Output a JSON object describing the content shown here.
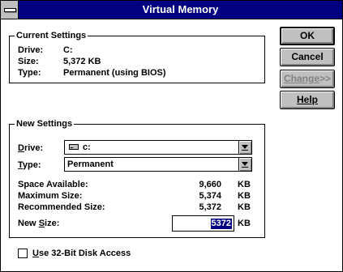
{
  "window": {
    "title": "Virtual Memory"
  },
  "current_settings": {
    "title": "Current Settings",
    "drive_label": "Drive:",
    "drive_value": "C:",
    "size_label": "Size:",
    "size_value": "5,372 KB",
    "type_label": "Type:",
    "type_value": "Permanent (using BIOS)"
  },
  "buttons": {
    "ok": "OK",
    "cancel": "Cancel",
    "change_prefix": "Change",
    "change_suffix": ">>",
    "help": "Help"
  },
  "new_settings": {
    "title": "New Settings",
    "drive_label_u": "D",
    "drive_label_rest": "rive:",
    "drive_value": "c:",
    "type_label_u": "T",
    "type_label_rest": "ype:",
    "type_value": "Permanent",
    "space_available_label": "Space Available:",
    "space_available_value": "9,660",
    "maximum_size_label": "Maximum Size:",
    "maximum_size_value": "5,374",
    "recommended_size_label": "Recommended Size:",
    "recommended_size_value": "5,372",
    "unit": "KB",
    "new_size_label_before": "New ",
    "new_size_label_u": "S",
    "new_size_label_after": "ize:",
    "new_size_value": "5372"
  },
  "checkbox": {
    "label_u": "U",
    "label_rest": "se 32-Bit Disk Access",
    "checked": false
  },
  "icons": {
    "system_menu": "system-menu-icon",
    "drive": "hard-drive-icon",
    "dropdown": "dropdown-arrow-icon"
  },
  "colors": {
    "titlebar": "#000080",
    "button_face": "#c0c0c0",
    "disabled_text": "#808080",
    "selection": "#000080"
  }
}
